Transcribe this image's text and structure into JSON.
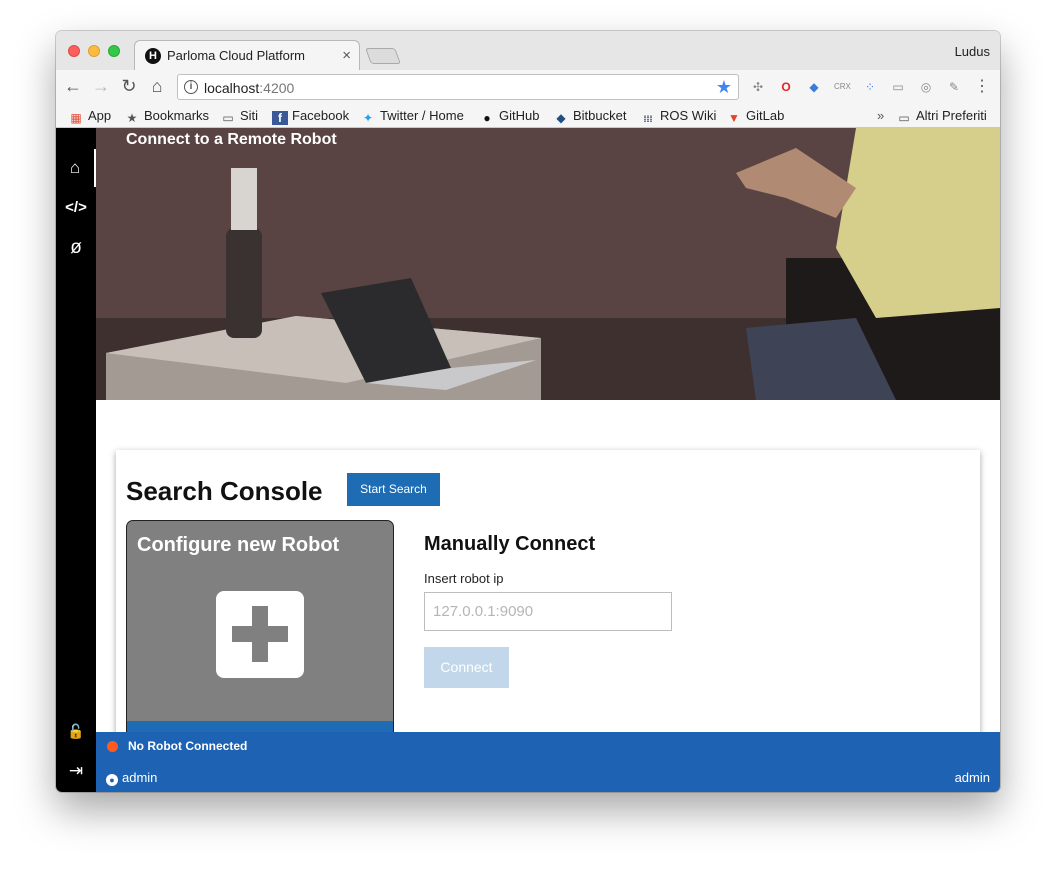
{
  "browser": {
    "tab_title": "Parloma Cloud Platform",
    "tab_favicon": "H",
    "tab_close": "×",
    "profile_name": "Ludus",
    "url_host": "localhost",
    "url_port": ":4200",
    "nav": {
      "back": "←",
      "forward": "→",
      "reload": "↻",
      "home": "⌂"
    }
  },
  "bookmarks": {
    "items": [
      {
        "label": "App",
        "icon": "apps-grid-icon",
        "glyph": "▦"
      },
      {
        "label": "Bookmarks",
        "icon": "star-icon",
        "glyph": "★"
      },
      {
        "label": "Siti",
        "icon": "folder-icon",
        "glyph": "▭"
      },
      {
        "label": "Facebook",
        "icon": "facebook-icon",
        "glyph": "f"
      },
      {
        "label": "Twitter / Home",
        "icon": "twitter-icon",
        "glyph": "✦"
      },
      {
        "label": "GitHub",
        "icon": "github-icon",
        "glyph": "●"
      },
      {
        "label": "Bitbucket",
        "icon": "bitbucket-icon",
        "glyph": "◆"
      },
      {
        "label": "ROS Wiki",
        "icon": "ros-icon",
        "glyph": "⁞⁞⁞"
      },
      {
        "label": "GitLab",
        "icon": "gitlab-icon",
        "glyph": "▼"
      }
    ],
    "overflow": "»",
    "other": "Altri Preferiti"
  },
  "sidebar": {
    "home": "⌂",
    "code": "</>",
    "ros": "ø",
    "lock": "🔓",
    "logout": "⇥"
  },
  "hero": {
    "title": "Connect to a Remote Robot"
  },
  "search_console": {
    "title": "Search Console",
    "start_button": "Start Search"
  },
  "robot_tile": {
    "title": "Configure new Robot"
  },
  "manual": {
    "title": "Manually Connect",
    "ip_label": "Insert robot ip",
    "ip_placeholder": "127.0.0.1:9090",
    "connect_button": "Connect"
  },
  "footer": {
    "status": "No Robot Connected",
    "user_left": "admin",
    "user_right": "admin"
  },
  "colors": {
    "primary": "#1e6db4",
    "footer": "#1e62b4",
    "status_dot": "#ff5a1f",
    "sidebar": "#000000"
  }
}
